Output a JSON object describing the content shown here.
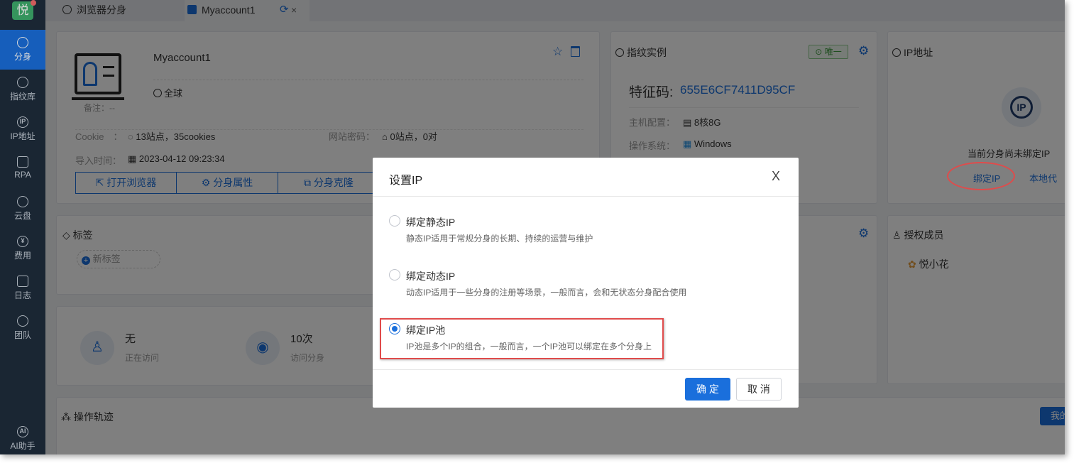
{
  "sidebar": {
    "logo": "悦",
    "items": [
      {
        "label": "分身",
        "icon": "chrome-icon"
      },
      {
        "label": "指纹库",
        "icon": "fingerprint-icon"
      },
      {
        "label": "IP地址",
        "icon": "ip-icon"
      },
      {
        "label": "RPA",
        "icon": "robot-icon"
      },
      {
        "label": "云盘",
        "icon": "cloud-icon"
      },
      {
        "label": "费用",
        "icon": "yen-icon"
      },
      {
        "label": "日志",
        "icon": "document-icon"
      },
      {
        "label": "团队",
        "icon": "team-icon"
      },
      {
        "label": "AI助手",
        "icon": "ai-icon"
      }
    ]
  },
  "tabs": [
    {
      "label": "浏览器分身"
    },
    {
      "label": "Myaccount1"
    }
  ],
  "profile": {
    "name": "Myaccount1",
    "note": "备注：--",
    "region": "全球",
    "cookie_label": "Cookie　：",
    "cookie_value": "13站点，35cookies",
    "pwd_label": "网站密码：",
    "pwd_value": "0站点，0对",
    "import_label": "导入时间：",
    "import_value": "2023-04-12 09:23:34",
    "buttons": [
      "打开浏览器",
      "分身属性",
      "分身克隆"
    ]
  },
  "fingerprint": {
    "title": "指纹实例",
    "badge": "唯一",
    "code_label": "特征码:",
    "code_value": "655E6CF7411D95CF",
    "host_label": "主机配置：",
    "host_value": "8核8G",
    "os_label": "操作系统：",
    "os_value": "Windows"
  },
  "ip_card": {
    "title": "IP地址",
    "empty_text": "当前分身尚未绑定IP",
    "bind_link": "绑定IP",
    "local_link": "本地代"
  },
  "tags": {
    "title": "标签",
    "new_tag": "新标签"
  },
  "auth": {
    "title": "授权成员",
    "member": "悦小花"
  },
  "stats": [
    {
      "value": "无",
      "label": "正在访问"
    },
    {
      "value": "10次",
      "label": "访问分身"
    }
  ],
  "track": {
    "title": "操作轨迹",
    "button": "我的"
  },
  "dialog": {
    "title": "设置IP",
    "close": "X",
    "options": [
      {
        "label": "绑定静态IP",
        "desc": "静态IP适用于常规分身的长期、持续的运营与维护",
        "selected": false
      },
      {
        "label": "绑定动态IP",
        "desc": "动态IP适用于一些分身的注册等场景，一般而言，会和无状态分身配合使用",
        "selected": false
      },
      {
        "label": "绑定IP池",
        "desc": "IP池是多个IP的组合，一般而言，一个IP池可以绑定在多个分身上",
        "selected": true
      }
    ],
    "confirm": "确 定",
    "cancel": "取 消"
  }
}
